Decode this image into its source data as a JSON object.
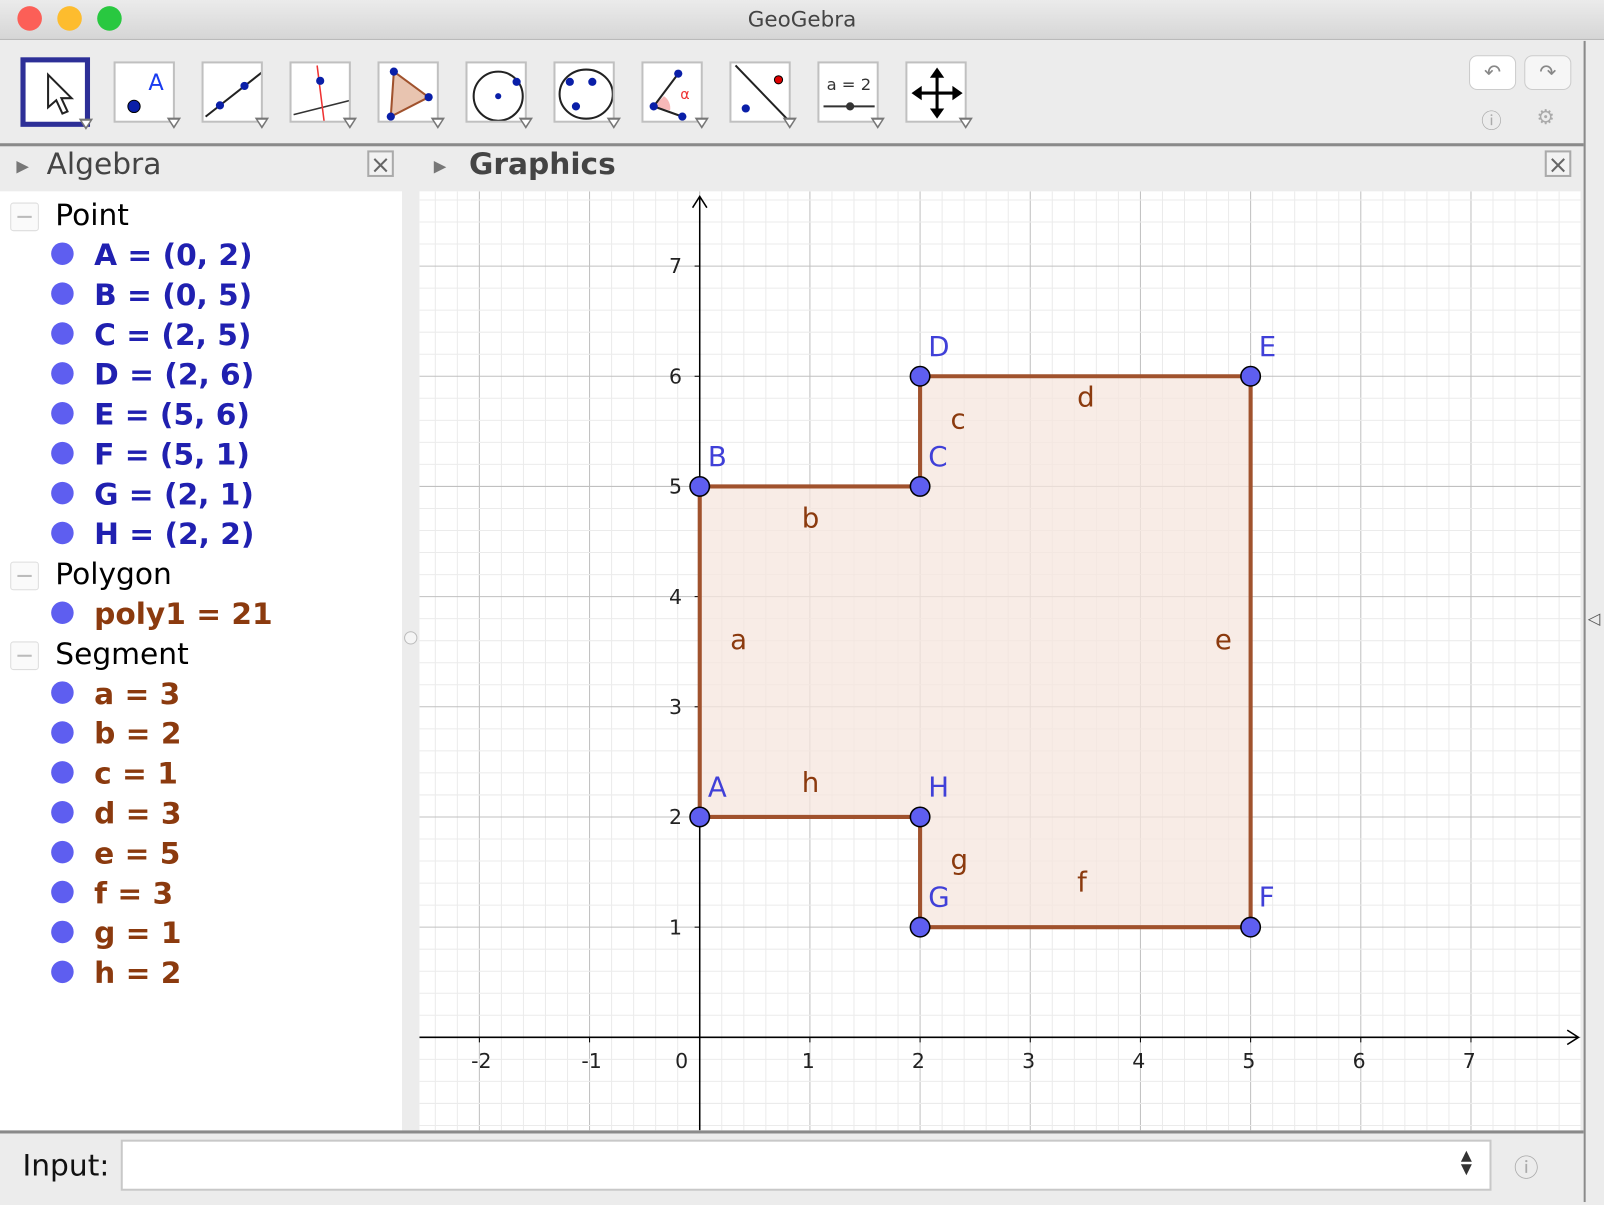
{
  "window": {
    "title": "GeoGebra"
  },
  "toolbar": {
    "tools": [
      {
        "name": "move-tool",
        "selected": true
      },
      {
        "name": "point-tool",
        "label": "A"
      },
      {
        "name": "line-tool"
      },
      {
        "name": "perpendicular-line-tool"
      },
      {
        "name": "polygon-tool"
      },
      {
        "name": "circle-center-point-tool"
      },
      {
        "name": "circle-three-points-tool"
      },
      {
        "name": "angle-tool",
        "label": "α"
      },
      {
        "name": "reflect-tool"
      },
      {
        "name": "slider-tool",
        "label": "a = 2"
      },
      {
        "name": "move-graphics-view-tool"
      }
    ],
    "undo_icon": "undo-icon",
    "redo_icon": "redo-icon"
  },
  "algebra": {
    "title": "Algebra",
    "groups": [
      {
        "label": "Point",
        "items": [
          {
            "text": "A = (0, 2)"
          },
          {
            "text": "B = (0, 5)"
          },
          {
            "text": "C = (2, 5)"
          },
          {
            "text": "D = (2, 6)"
          },
          {
            "text": "E = (5, 6)"
          },
          {
            "text": "F = (5, 1)"
          },
          {
            "text": "G = (2, 1)"
          },
          {
            "text": "H = (2, 2)"
          }
        ]
      },
      {
        "label": "Polygon",
        "items": [
          {
            "text": "poly1 = 21"
          }
        ]
      },
      {
        "label": "Segment",
        "items": [
          {
            "text": "a = 3"
          },
          {
            "text": "b = 2"
          },
          {
            "text": "c = 1"
          },
          {
            "text": "d = 3"
          },
          {
            "text": "e = 5"
          },
          {
            "text": "f = 3"
          },
          {
            "text": "g = 1"
          },
          {
            "text": "h = 2"
          }
        ]
      }
    ]
  },
  "graphics": {
    "title": "Graphics",
    "x_ticks": [
      "-2",
      "-1",
      "0",
      "1",
      "2",
      "3",
      "4",
      "5",
      "6",
      "7"
    ],
    "y_ticks": [
      "1",
      "2",
      "3",
      "4",
      "5",
      "6",
      "7"
    ],
    "points": [
      {
        "name": "A",
        "x": 0,
        "y": 2
      },
      {
        "name": "B",
        "x": 0,
        "y": 5
      },
      {
        "name": "C",
        "x": 2,
        "y": 5
      },
      {
        "name": "D",
        "x": 2,
        "y": 6
      },
      {
        "name": "E",
        "x": 5,
        "y": 6
      },
      {
        "name": "F",
        "x": 5,
        "y": 1
      },
      {
        "name": "G",
        "x": 2,
        "y": 1
      },
      {
        "name": "H",
        "x": 2,
        "y": 2
      }
    ],
    "segments": [
      {
        "name": "a",
        "from": "A",
        "to": "B"
      },
      {
        "name": "b",
        "from": "B",
        "to": "C"
      },
      {
        "name": "c",
        "from": "C",
        "to": "D"
      },
      {
        "name": "d",
        "from": "D",
        "to": "E"
      },
      {
        "name": "e",
        "from": "E",
        "to": "F"
      },
      {
        "name": "f",
        "from": "F",
        "to": "G"
      },
      {
        "name": "g",
        "from": "G",
        "to": "H"
      },
      {
        "name": "h",
        "from": "H",
        "to": "A"
      }
    ],
    "colors": {
      "point": "#5e5ef0",
      "point_label": "#4040d8",
      "segment": "#a0522d",
      "segment_label": "#8b3a0e",
      "fill": "#f5e6de"
    }
  },
  "input": {
    "label": "Input:",
    "value": ""
  },
  "colors": {
    "point_text": "#2020b0",
    "dependent_text": "#8b3a0e",
    "selected_tool": "#2d2f97"
  }
}
